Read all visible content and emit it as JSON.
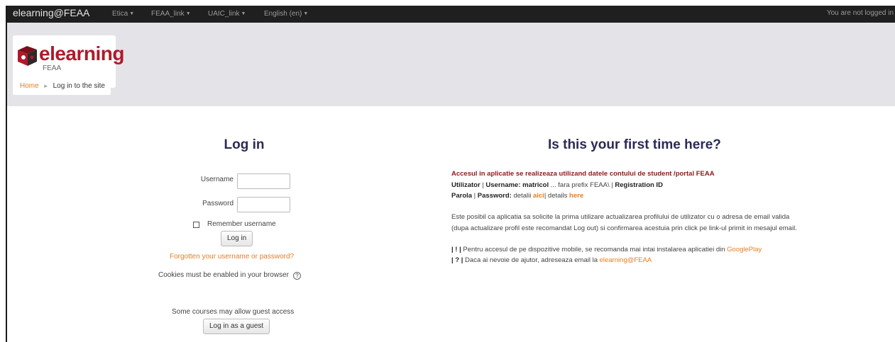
{
  "navbar": {
    "brand": "elearning@FEAA",
    "menu": [
      {
        "label": "Etica"
      },
      {
        "label": "FEAA_link"
      },
      {
        "label": "UAIC_link"
      },
      {
        "label": "English (en)"
      }
    ],
    "login_status": "You are not logged in"
  },
  "header": {
    "logo_word": "elearning",
    "logo_sub": "FEAA",
    "breadcrumb": {
      "home": "Home",
      "current": "Log in to the site"
    }
  },
  "login": {
    "title": "Log in",
    "username_label": "Username",
    "username_value": "",
    "password_label": "Password",
    "password_value": "",
    "remember_label": "Remember username",
    "remember_checked": false,
    "login_button": "Log in",
    "forgot_link": "Forgotten your username or password?",
    "cookies_text": "Cookies must be enabled in your browser",
    "help_icon": "?",
    "guest_text": "Some courses may allow guest access",
    "guest_button": "Log in as a guest"
  },
  "first_time": {
    "title": "Is this your first time here?",
    "access_line": "Accesul in aplicatie se realizeaza utilizand datele contului de student /portal FEAA",
    "user_line": {
      "bold1": "Utilizator",
      "sep1": " | ",
      "bold2": "Username: matricol",
      "mid": " ... fara prefix FEAA\\ | ",
      "bold3": "Registration ID"
    },
    "password_line": {
      "bold1": "Parola",
      "sep1": " | ",
      "bold2": "Password:",
      "text1": " detalii ",
      "link1": "aici",
      "text2": "| details ",
      "link2": "here"
    },
    "email_line1": "Este posibil ca aplicatia sa solicite la prima utilizare actualizarea profilului de utilizator cu o adresa de email valida",
    "email_line2": "(dupa actualizare profil este recomandat Log out) si confirmarea acestuia prin click pe link-ul primit in mesajul email.",
    "mobile_line": {
      "prefix": "| ! |",
      "text": " Pentru accesul de pe dispozitive mobile, se recomanda mai intai instalarea aplicatiei din ",
      "link": "GooglePlay"
    },
    "help_line": {
      "prefix": "| ? |",
      "text": " Daca ai nevoie de ajutor, adreseaza email la ",
      "link": "elearning@FEAA"
    }
  },
  "colors": {
    "accent": "#e67e22",
    "heading": "#2b2b55",
    "alert_red": "#8b1a1a",
    "navbar_bg": "#1f1f1f"
  }
}
